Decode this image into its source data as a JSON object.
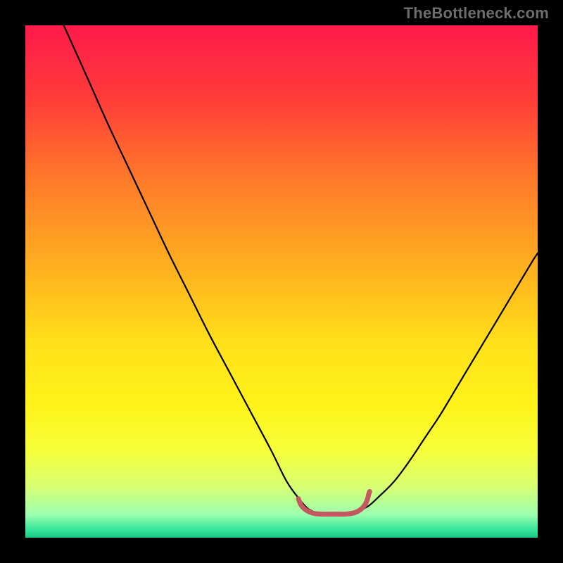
{
  "watermark": {
    "text": "TheBottleneck.com"
  },
  "gradient": {
    "stops": [
      {
        "offset": 0.0,
        "color": "#ff1a4b"
      },
      {
        "offset": 0.14,
        "color": "#ff3b3a"
      },
      {
        "offset": 0.3,
        "color": "#ff7a2a"
      },
      {
        "offset": 0.48,
        "color": "#ffb21f"
      },
      {
        "offset": 0.62,
        "color": "#ffe01a"
      },
      {
        "offset": 0.74,
        "color": "#fff31a"
      },
      {
        "offset": 0.83,
        "color": "#f6ff3a"
      },
      {
        "offset": 0.9,
        "color": "#d8ff72"
      },
      {
        "offset": 0.955,
        "color": "#9cffb0"
      },
      {
        "offset": 0.985,
        "color": "#35e59a"
      },
      {
        "offset": 1.0,
        "color": "#18c884"
      }
    ]
  },
  "chart_data": {
    "type": "line",
    "title": "",
    "xlabel": "",
    "ylabel": "",
    "xlim": [
      0,
      100
    ],
    "ylim": [
      0,
      100
    ],
    "grid": false,
    "legend": false,
    "series": [
      {
        "name": "left-branch",
        "color": "#000000",
        "width": 2.2,
        "x": [
          7.5,
          12,
          16,
          20,
          24,
          28,
          32,
          36,
          40,
          44,
          48,
          51,
          53.5,
          55,
          56
        ],
        "y": [
          100,
          90,
          81,
          72.5,
          64,
          55.5,
          47.5,
          39.5,
          32,
          24.5,
          17,
          11,
          7.5,
          5.8,
          5.2
        ]
      },
      {
        "name": "right-branch",
        "color": "#000000",
        "width": 2.2,
        "x": [
          65,
          67,
          69,
          72,
          75,
          78,
          81,
          84,
          87,
          90,
          93,
          96,
          99,
          100
        ],
        "y": [
          5.2,
          6.2,
          8,
          11,
          15,
          19.5,
          24,
          29,
          34,
          39,
          44,
          49,
          54,
          55.5
        ]
      },
      {
        "name": "bottom-highlight",
        "color": "#c4585f",
        "width": 7,
        "x": [
          53.3,
          53.8,
          54.5,
          55.5,
          56.5,
          58,
          59.5,
          61,
          62.5,
          64,
          65,
          65.8,
          66.4,
          66.8,
          67,
          67.2
        ],
        "y": [
          7.6,
          6.4,
          5.6,
          5.0,
          4.7,
          4.6,
          4.6,
          4.6,
          4.6,
          4.8,
          5.2,
          5.8,
          6.6,
          7.6,
          8.4,
          9.0
        ]
      }
    ]
  }
}
